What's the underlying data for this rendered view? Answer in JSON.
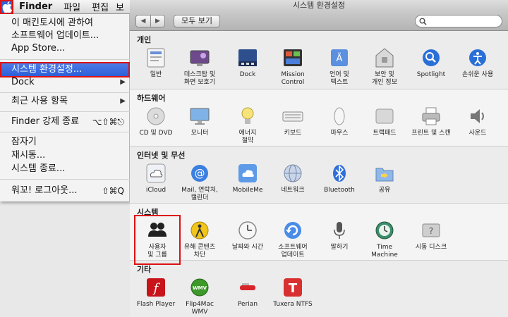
{
  "menubar": {
    "app_name": "Finder",
    "items": [
      "파일",
      "편집",
      "보"
    ]
  },
  "apple_menu": {
    "items": [
      {
        "label": "이 매킨토시에 관하여"
      },
      {
        "label": "소프트웨어 업데이트..."
      },
      {
        "label": "App Store..."
      },
      {
        "label": "시스템 환경설정..."
      },
      {
        "label": "Dock"
      },
      {
        "label": "최근 사용 항목"
      },
      {
        "label": "Finder 강제 종료",
        "shortcut": "⌥⇧⌘⎋"
      },
      {
        "label": "잠자기"
      },
      {
        "label": "재시동..."
      },
      {
        "label": "시스템 종료..."
      },
      {
        "label": "워꼬! 로그아웃...",
        "shortcut": "⇧⌘Q"
      }
    ]
  },
  "window": {
    "title": "시스템 환경설정",
    "show_all_label": "모두 보기",
    "search_placeholder": ""
  },
  "sections": [
    {
      "title": "개인",
      "panes": [
        {
          "label": "일반",
          "icon": "general-icon"
        },
        {
          "label": "데스크탑 및\n화면 보호기",
          "icon": "desktop-icon"
        },
        {
          "label": "Dock",
          "icon": "dock-icon"
        },
        {
          "label": "Mission\nControl",
          "icon": "mission-control-icon"
        },
        {
          "label": "언어 및\n텍스트",
          "icon": "language-icon"
        },
        {
          "label": "보안 및\n개인 정보",
          "icon": "security-icon"
        },
        {
          "label": "Spotlight",
          "icon": "spotlight-icon"
        },
        {
          "label": "손쉬운 사용",
          "icon": "accessibility-icon"
        }
      ]
    },
    {
      "title": "하드웨어",
      "panes": [
        {
          "label": "CD 및 DVD",
          "icon": "cd-icon"
        },
        {
          "label": "모니터",
          "icon": "monitor-icon"
        },
        {
          "label": "에너지\n절약",
          "icon": "energy-icon"
        },
        {
          "label": "키보드",
          "icon": "keyboard-icon"
        },
        {
          "label": "마우스",
          "icon": "mouse-icon"
        },
        {
          "label": "트랙패드",
          "icon": "trackpad-icon"
        },
        {
          "label": "프린트 및 스캔",
          "icon": "printer-icon"
        },
        {
          "label": "사운드",
          "icon": "sound-icon"
        }
      ]
    },
    {
      "title": "인터넷 및 무선",
      "panes": [
        {
          "label": "iCloud",
          "icon": "icloud-icon"
        },
        {
          "label": "Mail, 연락처,\n캘린더",
          "icon": "mail-icon"
        },
        {
          "label": "MobileMe",
          "icon": "mobileme-icon"
        },
        {
          "label": "네트워크",
          "icon": "network-icon"
        },
        {
          "label": "Bluetooth",
          "icon": "bluetooth-icon"
        },
        {
          "label": "공유",
          "icon": "sharing-icon"
        }
      ]
    },
    {
      "title": "시스템",
      "panes": [
        {
          "label": "사용자\n및 그룹",
          "icon": "users-icon"
        },
        {
          "label": "유해 콘텐츠\n차단",
          "icon": "parental-icon"
        },
        {
          "label": "날짜와 시간",
          "icon": "clock-icon"
        },
        {
          "label": "소프트웨어\n업데이트",
          "icon": "update-icon"
        },
        {
          "label": "말하기",
          "icon": "speech-icon"
        },
        {
          "label": "Time Machine",
          "icon": "timemachine-icon"
        },
        {
          "label": "시동 디스크",
          "icon": "startup-disk-icon"
        }
      ]
    },
    {
      "title": "기타",
      "panes": [
        {
          "label": "Flash Player",
          "icon": "flash-icon"
        },
        {
          "label": "Flip4Mac\nWMV",
          "icon": "flip4mac-icon"
        },
        {
          "label": "Perian",
          "icon": "perian-icon"
        },
        {
          "label": "Tuxera NTFS",
          "icon": "tuxera-icon"
        }
      ]
    }
  ],
  "colors": {
    "highlight": "#dd1111",
    "menu_selected": "#2a5bd6"
  }
}
